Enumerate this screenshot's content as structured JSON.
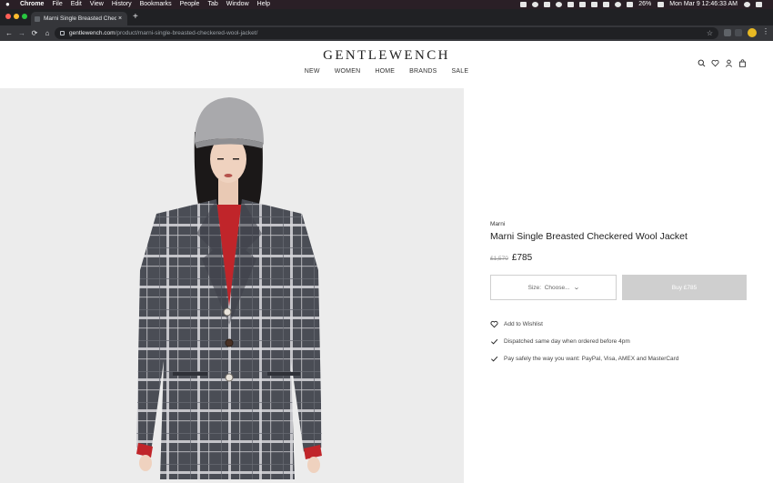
{
  "menubar": {
    "apple": "",
    "app": "Chrome",
    "menus": [
      "File",
      "Edit",
      "View",
      "History",
      "Bookmarks",
      "People",
      "Tab",
      "Window",
      "Help"
    ],
    "battery": "26%",
    "datetime": "Mon Mar 9  12:46:33 AM"
  },
  "browser": {
    "tab_title": "Marni Single Breasted Checkered",
    "tab_close": "×",
    "new_tab": "+",
    "back": "←",
    "forward": "→",
    "reload": "⟳",
    "home": "⌂",
    "url_host": "gentlewench.com",
    "url_path": "/product/marni-single-breasted-checkered-wool-jacket/",
    "star": "☆",
    "kebab": "⋮"
  },
  "site": {
    "logo": "GENTLEWENCH",
    "nav": [
      "NEW",
      "WOMEN",
      "HOME",
      "BRANDS",
      "SALE"
    ]
  },
  "product": {
    "brand": "Marni",
    "title": "Marni Single Breasted Checkered Wool Jacket",
    "old_price": "£1,570",
    "price": "£785",
    "size_label": "Size:",
    "size_value": "Choose...",
    "size_chevron": "⌄",
    "buy_label": "Buy £785",
    "benefits": [
      "Add to Wishlist",
      "Dispatched same day when ordered before 4pm",
      "Pay safely the way you want: PayPal, Visa, AMEX and MasterCard"
    ]
  },
  "colors": {
    "menubar": "#2a1f26",
    "tabstrip": "#202124",
    "toolbar": "#35363a",
    "hero_bg": "#ececec",
    "buy_button": "#cfcfcf",
    "jacket": "#4a4d55",
    "sweater": "#c0252a"
  }
}
